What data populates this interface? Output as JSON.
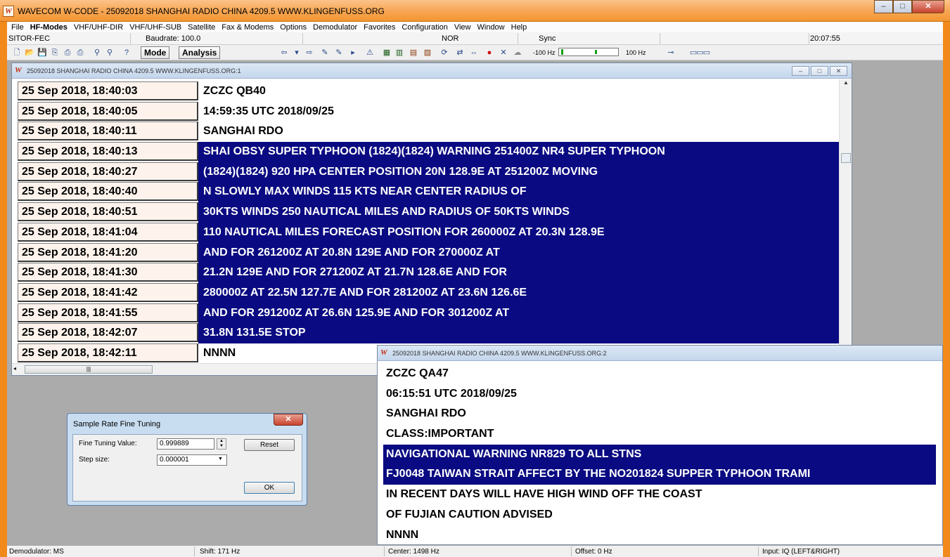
{
  "window": {
    "title": "WAVECOM W-CODE - 25092018 SHANGHAI RADIO CHINA 4209.5 WWW.KLINGENFUSS.ORG",
    "icon_letter": "W",
    "min": "–",
    "max": "□",
    "close": "✕"
  },
  "menu": [
    {
      "label": "File"
    },
    {
      "label": "HF-Modes",
      "bold": true
    },
    {
      "label": "VHF/UHF-DIR"
    },
    {
      "label": "VHF/UHF-SUB"
    },
    {
      "label": "Satellite"
    },
    {
      "label": "Fax & Modems"
    },
    {
      "label": "Options"
    },
    {
      "label": "Demodulator"
    },
    {
      "label": "Favorites"
    },
    {
      "label": "Configuration"
    },
    {
      "label": "View"
    },
    {
      "label": "Window"
    },
    {
      "label": "Help"
    }
  ],
  "modebar": {
    "mode": "SITOR-FEC",
    "baudrate": "Baudrate: 100.0",
    "polarity": "NOR",
    "sync": "Sync",
    "time": "20:07:55"
  },
  "toolbar": {
    "mode_label": "Mode",
    "analysis_label": "Analysis",
    "freq_low": "-100 Hz",
    "freq_high": "100 Hz"
  },
  "child1": {
    "title": "25092018 SHANGHAI RADIO CHINA 4209.5 WWW.KLINGENFUSS.ORG:1",
    "rows": [
      {
        "ts": "25 Sep 2018, 18:40:03",
        "msg": "ZCZC QB40",
        "hl": false
      },
      {
        "ts": "25 Sep 2018, 18:40:05",
        "msg": "14:59:35 UTC 2018/09/25",
        "hl": false
      },
      {
        "ts": "25 Sep 2018, 18:40:11",
        "msg": "SANGHAI RDO",
        "hl": false
      },
      {
        "ts": "25 Sep 2018, 18:40:13",
        "msg": "SHAI OBSY SUPER TYPHOON (1824)(1824) WARNING 251400Z NR4 SUPER TYPHOON",
        "hl": true
      },
      {
        "ts": "25 Sep 2018, 18:40:27",
        "msg": "(1824)(1824) 920 HPA CENTER POSITION 20N 128.9E AT 251200Z MOVING",
        "hl": true
      },
      {
        "ts": "25 Sep 2018, 18:40:40",
        "msg": "N SLOWLY MAX WINDS 115 KTS NEAR CENTER RADIUS OF",
        "hl": true
      },
      {
        "ts": "25 Sep 2018, 18:40:51",
        "msg": "30KTS WINDS 250 NAUTICAL MILES AND RADIUS OF 50KTS WINDS",
        "hl": true
      },
      {
        "ts": "25 Sep 2018, 18:41:04",
        "msg": "110 NAUTICAL MILES FORECAST POSITION FOR 260000Z AT 20.3N 128.9E",
        "hl": true
      },
      {
        "ts": "25 Sep 2018, 18:41:20",
        "msg": "AND FOR 261200Z AT 20.8N 129E AND FOR 270000Z AT",
        "hl": true
      },
      {
        "ts": "25 Sep 2018, 18:41:30",
        "msg": "21.2N 129E AND FOR 271200Z AT 21.7N 128.6E AND FOR",
        "hl": true
      },
      {
        "ts": "25 Sep 2018, 18:41:42",
        "msg": "280000Z AT 22.5N 127.7E AND FOR 281200Z AT 23.6N 126.6E",
        "hl": true
      },
      {
        "ts": "25 Sep 2018, 18:41:55",
        "msg": "AND FOR 291200Z AT 26.6N 125.9E AND FOR 301200Z AT",
        "hl": true
      },
      {
        "ts": "25 Sep 2018, 18:42:07",
        "msg": "31.8N 131.5E STOP",
        "hl": true
      },
      {
        "ts": "25 Sep 2018, 18:42:11",
        "msg": "NNNN",
        "hl": false
      }
    ]
  },
  "child2": {
    "title": "25092018 SHANGHAI RADIO CHINA 4209.5 WWW.KLINGENFUSS.ORG:2",
    "rows": [
      {
        "msg": "ZCZC QA47",
        "hl": false
      },
      {
        "msg": "06:15:51 UTC 2018/09/25",
        "hl": false
      },
      {
        "msg": "SANGHAI RDO",
        "hl": false
      },
      {
        "msg": "CLASS:IMPORTANT",
        "hl": false
      },
      {
        "msg": "NAVIGATIONAL WARNING NR829 TO ALL STNS",
        "hl": true
      },
      {
        "msg": "FJ0048 TAIWAN STRAIT AFFECT BY THE NO201824 SUPPER TYPHOON TRAMI",
        "hl": true
      },
      {
        "msg": "IN RECENT DAYS WILL HAVE HIGH WIND OFF THE COAST",
        "hl": false
      },
      {
        "msg": "OF FUJIAN CAUTION ADVISED",
        "hl": false
      },
      {
        "msg": "NNNN",
        "hl": false
      }
    ]
  },
  "dialog": {
    "title": "Sample Rate Fine Tuning",
    "fine_label": "Fine Tuning Value:",
    "fine_value": "0.999889",
    "step_label": "Step size:",
    "step_value": "0.000001",
    "reset": "Reset",
    "ok": "OK",
    "close": "✕"
  },
  "status": {
    "demod": "Demodulator: MS",
    "shift": "Shift: 171 Hz",
    "center": "Center: 1498 Hz",
    "offset": "Offset: 0 Hz",
    "input": "Input: IQ (LEFT&RIGHT)"
  }
}
